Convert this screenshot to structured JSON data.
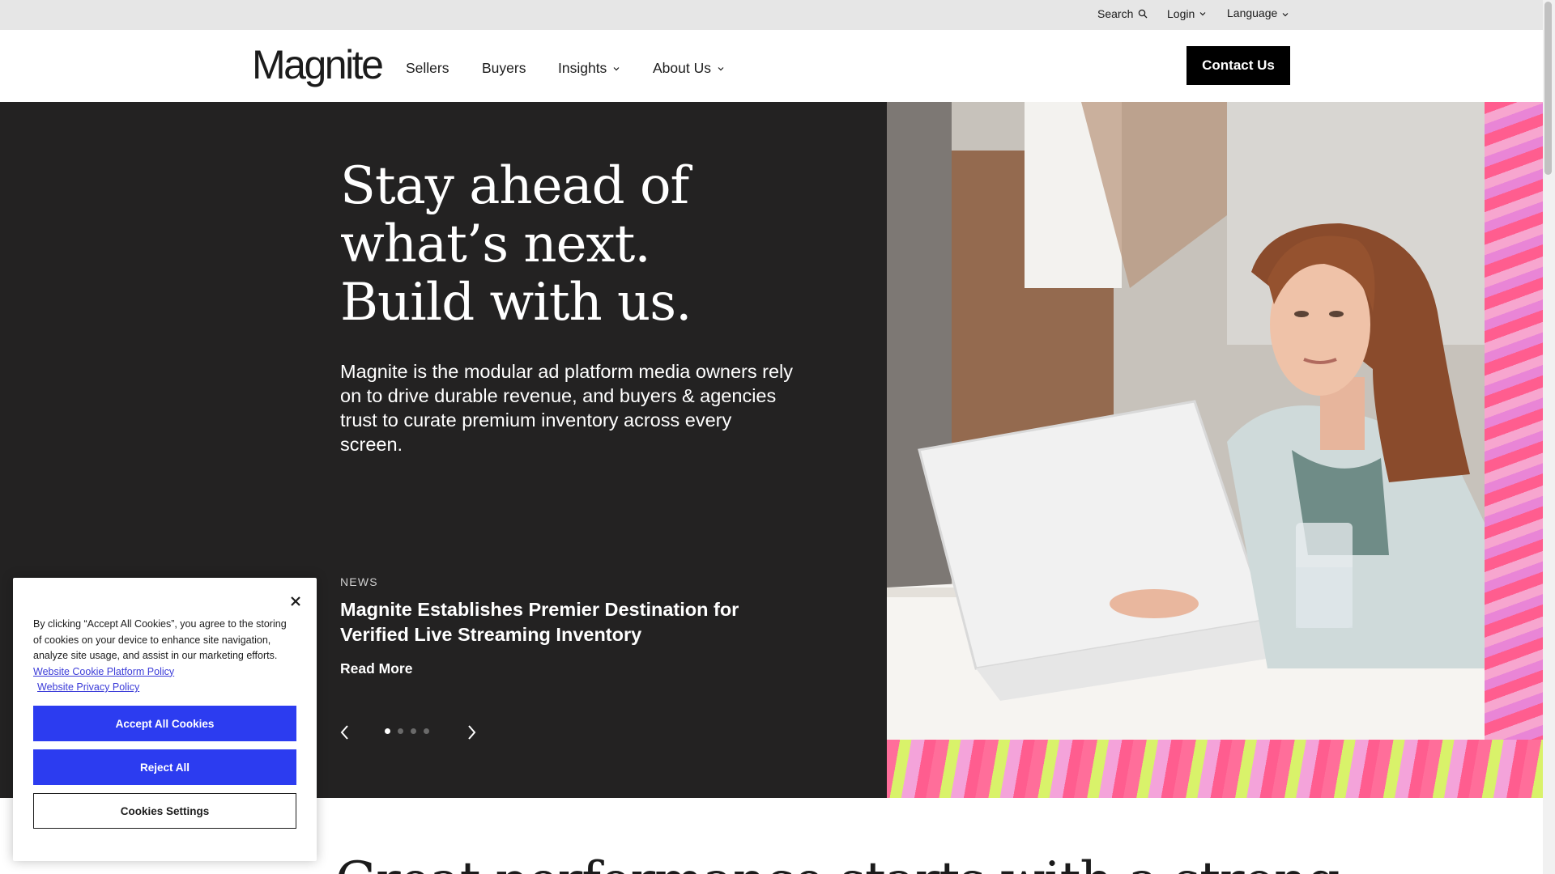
{
  "utility": {
    "search_label": "Search",
    "login_label": "Login",
    "language_label": "Language"
  },
  "header": {
    "logo_text": "Magnite",
    "nav": {
      "sellers": "Sellers",
      "buyers": "Buyers",
      "insights": "Insights",
      "about": "About Us"
    },
    "contact_label": "Contact Us"
  },
  "hero": {
    "title_lines": [
      "Stay ahead of",
      "what’s next.",
      "Build with us."
    ],
    "description": "Magnite is the modular ad platform media owners rely on to drive durable revenue, and buyers & agencies trust to curate premium inventory across every screen.",
    "news_label": "NEWS",
    "news_title": "Magnite Establishes Premier Destination for Verified Live Streaming Inventory",
    "read_more": "Read More",
    "carousel": {
      "slide_count": 4,
      "active_index": 0
    }
  },
  "cookie_banner": {
    "text": "By clicking “Accept All Cookies”, you agree to the storing of cookies on your device to enhance site navigation, analyze site usage, and assist in our marketing efforts.",
    "link_cookie_policy": "Website Cookie Platform Policy",
    "link_privacy_policy": "Website Privacy Policy",
    "accept_label": "Accept All Cookies",
    "reject_label": "Reject All",
    "settings_label": "Cookies Settings",
    "button_color": "#2c3cf0"
  },
  "section": {
    "heading": "Great performance starts with a strong"
  },
  "colors": {
    "hero_bg": "#232222",
    "utility_bg": "#e6e6e6",
    "contact_bg": "#000000"
  }
}
